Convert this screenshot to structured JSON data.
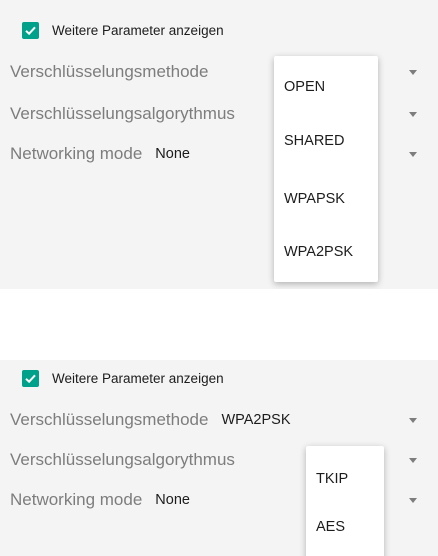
{
  "top_panel": {
    "checkbox": {
      "label": "Weitere Parameter anzeigen",
      "checked": true
    },
    "rows": [
      {
        "label": "Verschlüsselungsmethode",
        "value": ""
      },
      {
        "label": "Verschlüsselungsalgorythmus",
        "value": ""
      },
      {
        "label": "Networking mode",
        "value": "None"
      }
    ],
    "dropdown_options": [
      "OPEN",
      "SHARED",
      "WPAPSK",
      "WPA2PSK"
    ]
  },
  "bottom_panel": {
    "checkbox": {
      "label": "Weitere Parameter anzeigen",
      "checked": true
    },
    "rows": [
      {
        "label": "Verschlüsselungsmethode",
        "value": "WPA2PSK"
      },
      {
        "label": "Verschlüsselungsalgorythmus",
        "value": ""
      },
      {
        "label": "Networking mode",
        "value": "None"
      }
    ],
    "dropdown_options": [
      "TKIP",
      "AES"
    ]
  },
  "colors": {
    "accent": "#00a18a",
    "panel_background": "#f4f4f4",
    "label_gray": "#7d7d7d",
    "text_dark": "#1c1c1c"
  }
}
